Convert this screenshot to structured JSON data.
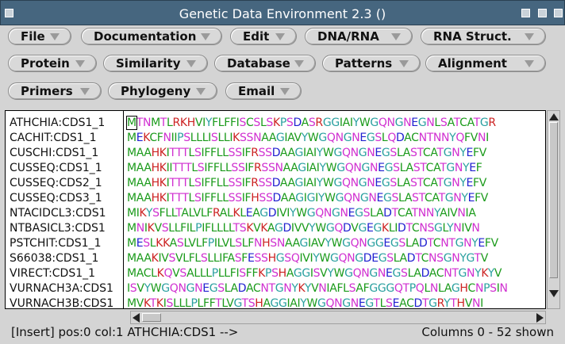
{
  "window": {
    "title": "Genetic Data Environment 2.3 ()"
  },
  "menus": [
    {
      "label": "File"
    },
    {
      "label": "Documentation"
    },
    {
      "label": "Edit"
    },
    {
      "label": "DNA/RNA"
    },
    {
      "label": "RNA Struct."
    },
    {
      "label": "Protein"
    },
    {
      "label": "Similarity"
    },
    {
      "label": "Database"
    },
    {
      "label": "Patterns"
    },
    {
      "label": "Alignment"
    },
    {
      "label": "Primers"
    },
    {
      "label": "Phylogeny"
    },
    {
      "label": "Email"
    }
  ],
  "sequences": [
    {
      "name": "ATHCHIA:CDS1_1",
      "seq": "MTNMTLRKHVIYFLFFISCSLSKPSDASRGGIAIYWGQNGNEGNLSATCATGR"
    },
    {
      "name": "CACHIT:CDS1_1",
      "seq": "MEKCFNIIPSLLLISLLIKSSNAAGIAVYWGQNGNEGSLQDACNTNNYQFVNI"
    },
    {
      "name": "CUSCHI:CDS1_1",
      "seq": "MAAHKITTTLSIFFLLSSIFRSSDAAGIAIYWGQNGNEGSLASTCATGNYEFV"
    },
    {
      "name": "CUSSEQ:CDS1_1",
      "seq": "MAAHKIITTTLSIFFLLSSIFRSSNAAGIAIYWGQNGNEGSLASTCATGNYEF"
    },
    {
      "name": "CUSSEQ:CDS2_1",
      "seq": "MAAHKITTTLSIFFLLSSIFRSSDAAGIAIYWGQNGNEGSLASTCATGNYEFV"
    },
    {
      "name": "CUSSEQ:CDS3_1",
      "seq": "MAAHKITTTLSIFFLLSSIFHSSDAAGIGIYWGQNGNEGSLASTCATGNYEFV"
    },
    {
      "name": "NTACIDCL3:CDS1",
      "seq": "MIKYSFLLTALVLFRALKLEAGDIVIYWGQNGNEGSLADTCATNNYAIVNIA"
    },
    {
      "name": "NTBASICL3:CDS1",
      "seq": "MNIKVSLLFILPIFLLLLTSKVKAGDIVVYWGQDVGEGKLIDTCNSGLYNIVN"
    },
    {
      "name": "PSTCHIT:CDS1_1",
      "seq": "MESLKKASLVLFPILVLSLFNHSNAAGIAVYWGQNGGEGSLADTCNTGNYEFV"
    },
    {
      "name": "S66038:CDS1_1",
      "seq": "MAAKIVSVLFLSLLIFASFESSHGSQIVIYWGQNGDEGSLADTCNSGNYGTV"
    },
    {
      "name": "VIRECT:CDS1_1",
      "seq": "MACLKQVSALLLPLLFISFFKPSHAGGISVYWGQNGNEGSLADACNTGNYKYV"
    },
    {
      "name": "VURNACH3A:CDS1",
      "seq": "ISVYWGQNGNEGSLADACNTGNYKYVNIAFLSAFGGGQTPQLNLAGHCNPSIN"
    },
    {
      "name": "VURNACH3B:CDS1",
      "seq": "MVKTKISLLLPLFFTLVGTSHAGGIAIYWGQNGNEGTLSEACDTGRYTHVNI"
    }
  ],
  "colors": {
    "hydrophobic": "#1a9a1a",
    "polar": "#d030d0",
    "acidic": "#2020d0",
    "basic": "#cc2222",
    "special": "#2aa0a0"
  },
  "status": {
    "left": "[Insert] pos:0 col:1   ATHCHIA:CDS1 -->",
    "right": "Columns 0 - 52 shown"
  }
}
